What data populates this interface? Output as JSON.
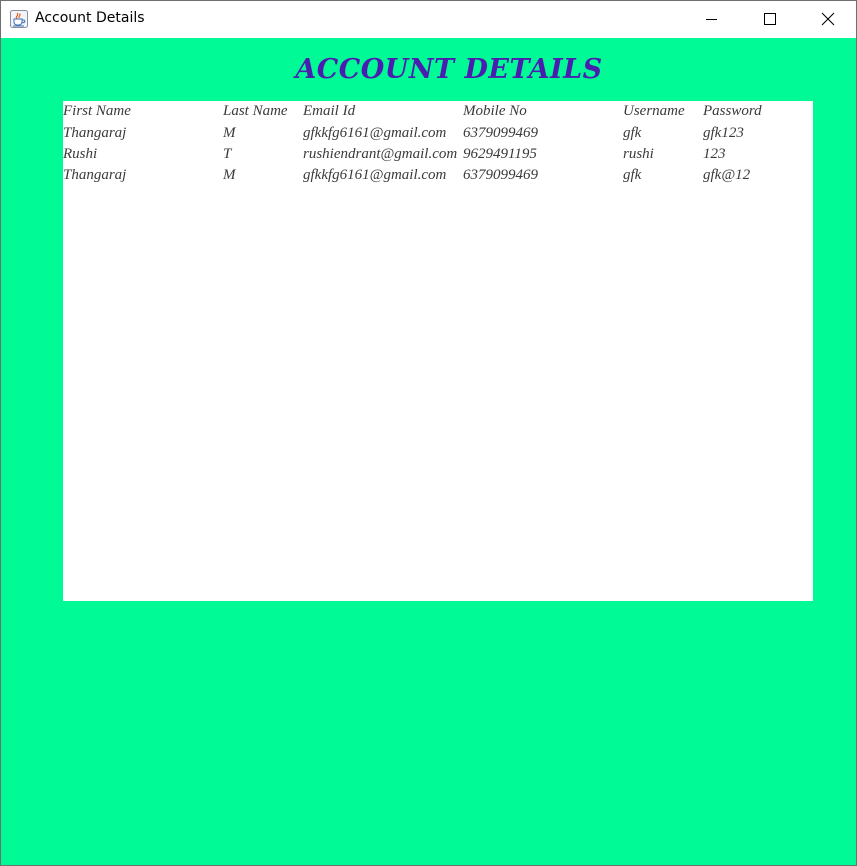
{
  "window": {
    "title": "Account Details",
    "app_icon": "java-coffee-cup-icon",
    "controls": [
      "minimize-icon",
      "maximize-icon",
      "close-icon"
    ]
  },
  "heading": "Account Details",
  "table": {
    "columns": [
      "First Name",
      "Last Name",
      "Email Id",
      "Mobile No",
      "Username",
      "Password"
    ],
    "rows": [
      [
        "Thangaraj",
        "M",
        "gfkkfg6161@gmail.com",
        "6379099469",
        "gfk",
        "gfk123"
      ],
      [
        "Rushi",
        "T",
        "rushiendrant@gmail.com",
        "9629491195",
        "rushi",
        "123"
      ],
      [
        "Thangaraj",
        "M",
        "gfkkfg6161@gmail.com",
        "6379099469",
        "gfk",
        "gfk@12"
      ]
    ]
  },
  "colors": {
    "background": "#00fa96",
    "heading": "#4b1cb0",
    "panel": "#ffffff",
    "cell_text": "#3a3a3a"
  }
}
